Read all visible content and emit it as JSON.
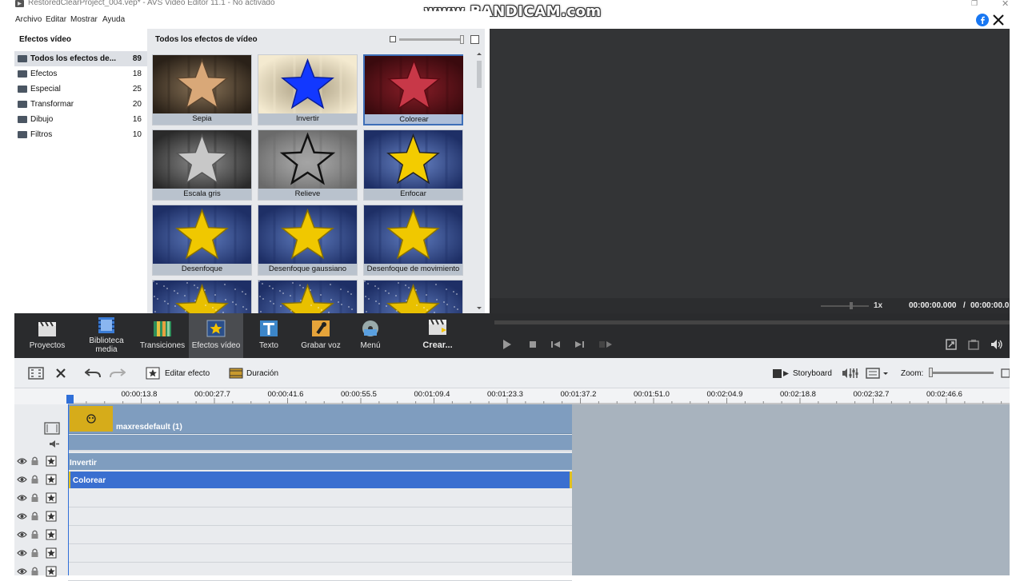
{
  "window": {
    "title": "RestoredClearProject_004.vep* - AVS Video Editor 11.1 - No activado",
    "watermark": "www.BANDICAM.com"
  },
  "menu": [
    "Archivo",
    "Editar",
    "Mostrar",
    "Ayuda"
  ],
  "effects_panel": {
    "title": "Efectos vídeo",
    "categories": [
      {
        "label": "Todos los efectos de...",
        "count": "89",
        "selected": true
      },
      {
        "label": "Efectos",
        "count": "18"
      },
      {
        "label": "Especial",
        "count": "25"
      },
      {
        "label": "Transformar",
        "count": "20"
      },
      {
        "label": "Dibujo",
        "count": "16"
      },
      {
        "label": "Filtros",
        "count": "10"
      }
    ]
  },
  "grid": {
    "title": "Todos los efectos de vídeo",
    "items": [
      {
        "label": "Sepia",
        "style": "sepia"
      },
      {
        "label": "Invertir",
        "style": "invert"
      },
      {
        "label": "Colorear",
        "style": "colorize",
        "selected": true
      },
      {
        "label": "Escala gris",
        "style": "gray"
      },
      {
        "label": "Relieve",
        "style": "relief"
      },
      {
        "label": "Enfocar",
        "style": "sharp"
      },
      {
        "label": "Desenfoque",
        "style": "blur"
      },
      {
        "label": "Desenfoque gaussiano",
        "style": "blur"
      },
      {
        "label": "Desenfoque de movimiento",
        "style": "blur"
      },
      {
        "label": "",
        "style": "noise"
      },
      {
        "label": "",
        "style": "noise"
      },
      {
        "label": "",
        "style": "noise"
      }
    ]
  },
  "preview": {
    "speed": "1x",
    "time": "00:00:00.000",
    "separator": "/",
    "total": "00:00:00.0"
  },
  "toolbar": {
    "items": [
      {
        "label": "Proyectos",
        "icon": "clapper-icon"
      },
      {
        "label": "Biblioteca media",
        "icon": "film-library-icon"
      },
      {
        "label": "Transiciones",
        "icon": "transitions-icon"
      },
      {
        "label": "Efectos vídeo",
        "icon": "star-effect-icon",
        "selected": true
      },
      {
        "label": "Texto",
        "icon": "text-t-icon"
      },
      {
        "label": "Grabar voz",
        "icon": "microphone-icon"
      },
      {
        "label": "Menú",
        "icon": "disc-menu-icon"
      },
      {
        "label": "Crear...",
        "icon": "create-clapper-icon"
      }
    ]
  },
  "timeline_toolbar": {
    "edit_effect": "Editar efecto",
    "duration": "Duración",
    "storyboard": "Storyboard",
    "zoom": "Zoom:"
  },
  "ruler": [
    "00:00:13.8",
    "00:00:27.7",
    "00:00:41.6",
    "00:00:55.5",
    "00:01:09.4",
    "00:01:23.3",
    "00:01:37.2",
    "00:01:51.0",
    "00:02:04.9",
    "00:02:18.8",
    "00:02:32.7",
    "00:02:46.6"
  ],
  "tracks": {
    "video_clip": "maxresdefault (1)",
    "effect_1": "Invertir",
    "effect_2": "Colorear"
  },
  "colors": {
    "accent": "#3a6fd0",
    "panel_dark": "#2a2b2d",
    "preview": "#333436",
    "clip": "#7f9dbf"
  }
}
